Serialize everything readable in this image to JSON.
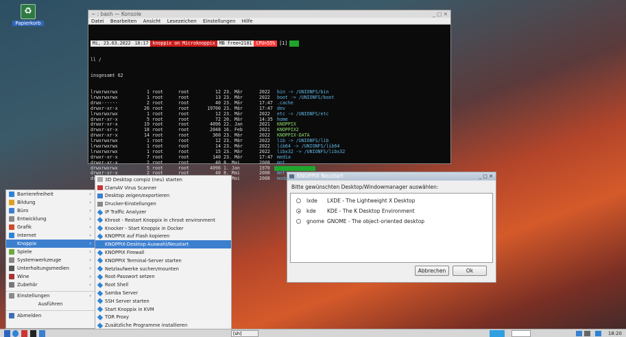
{
  "desktop": {
    "trash_label": "Papierkorb"
  },
  "terminal": {
    "title": "~ : bash — Konsole",
    "controls": "_ □ ✕",
    "menu": [
      "Datei",
      "Bearbeiten",
      "Ansicht",
      "Lesezeichen",
      "Einstellungen",
      "Hilfe"
    ],
    "status": {
      "date": "Mi, 23.03.2022",
      "time": "18:17",
      "host": "knoppix on Microknoppix",
      "mem": "MB free=2101",
      "cpu": "CPU=55%",
      "tag": "[1]"
    },
    "cmd": "ll /",
    "total": "insgesamt 62",
    "rows": [
      {
        "perm": "lrwxrwxrwx",
        "links": "1",
        "owner": "root",
        "group": "root",
        "size": "12",
        "date": "23. Mär",
        "time": "2022",
        "name": "bin -> /UNIONFS/bin"
      },
      {
        "perm": "lrwxrwxrwx",
        "links": "1",
        "owner": "root",
        "group": "root",
        "size": "13",
        "date": "23. Mär",
        "time": "2022",
        "name": "boot -> /UNIONFS/boot"
      },
      {
        "perm": "drwx------",
        "links": "2",
        "owner": "root",
        "group": "root",
        "size": "40",
        "date": "23. Mär",
        "time": "17:47",
        "name": ".cache"
      },
      {
        "perm": "drwxr-xr-x",
        "links": "26",
        "owner": "root",
        "group": "root",
        "size": "19700",
        "date": "23. Mär",
        "time": "17:47",
        "name": "dev"
      },
      {
        "perm": "lrwxrwxrwx",
        "links": "1",
        "owner": "root",
        "group": "root",
        "size": "12",
        "date": "23. Mär",
        "time": "2022",
        "name": "etc -> /UNIONFS/etc"
      },
      {
        "perm": "drwxr-xr-x",
        "links": "5",
        "owner": "root",
        "group": "root",
        "size": "72",
        "date": "20. Mär",
        "time": "14:35",
        "name": "home"
      },
      {
        "perm": "drwxr-xr-x",
        "links": "19",
        "owner": "root",
        "group": "root",
        "size": "4096",
        "date": "22. Jan",
        "time": "2021",
        "name": "KNOPPIX"
      },
      {
        "perm": "drwxr-xr-x",
        "links": "18",
        "owner": "root",
        "group": "root",
        "size": "2048",
        "date": "16. Feb",
        "time": "2021",
        "name": "KNOPPIX2"
      },
      {
        "perm": "drwxr-xr-x",
        "links": "14",
        "owner": "root",
        "group": "root",
        "size": "360",
        "date": "23. Mär",
        "time": "2022",
        "name": "KNOPPIX-DATA"
      },
      {
        "perm": "lrwxrwxrwx",
        "links": "1",
        "owner": "root",
        "group": "root",
        "size": "12",
        "date": "23. Mär",
        "time": "2022",
        "name": "lib -> /UNIONFS/lib"
      },
      {
        "perm": "lrwxrwxrwx",
        "links": "1",
        "owner": "root",
        "group": "root",
        "size": "14",
        "date": "23. Mär",
        "time": "2022",
        "name": "lib64 -> /UNIONFS/lib64"
      },
      {
        "perm": "lrwxrwxrwx",
        "links": "1",
        "owner": "root",
        "group": "root",
        "size": "15",
        "date": "23. Mär",
        "time": "2022",
        "name": "libx32 -> /UNIONFS/libx32"
      },
      {
        "perm": "drwxr-xr-x",
        "links": "7",
        "owner": "root",
        "group": "root",
        "size": "140",
        "date": "23. Mär",
        "time": "17:47",
        "name": "media"
      },
      {
        "perm": "drwxr-xr-x",
        "links": "2",
        "owner": "root",
        "group": "root",
        "size": "40",
        "date": "8. Mai",
        "time": "2008",
        "name": "mnt"
      },
      {
        "perm": "drwxrwxrwx",
        "links": "5",
        "owner": "root",
        "group": "root",
        "size": "4096",
        "date": "1. Jan",
        "time": "1970",
        "name": ""
      },
      {
        "perm": "drwxr-xr-x",
        "links": "2",
        "owner": "root",
        "group": "root",
        "size": "40",
        "date": "8. Mai",
        "time": "2008",
        "name": "mnt-user"
      },
      {
        "perm": "drwxr-xr-x",
        "links": "2",
        "owner": "root",
        "group": "root",
        "size": "40",
        "date": "8. Mai",
        "time": "2008",
        "name": "modules"
      }
    ]
  },
  "dialog": {
    "title": "KNOPPIX Neustart",
    "controls": "_ □ ✕",
    "prompt": "Bitte gewünschten Desktop/Windowmanager auswählen:",
    "options": [
      {
        "key": "lxde",
        "desc": "LXDE - The Lightweight X Desktop",
        "selected": false
      },
      {
        "key": "kde",
        "desc": "KDE - The K Desktop Environment",
        "selected": true
      },
      {
        "key": "gnome",
        "desc": "GNOME - The object-oriented desktop",
        "selected": false
      }
    ],
    "cancel": "Abbrechen",
    "ok": "Ok"
  },
  "menu": {
    "items": [
      "Barrierefreiheit",
      "Bildung",
      "Büro",
      "Entwicklung",
      "Grafik",
      "Internet",
      "Knoppix",
      "Spiele",
      "Systemwerkzeuge",
      "Unterhaltungsmedien",
      "Wine",
      "Zubehör"
    ],
    "settings": "Einstellungen",
    "run": "Ausführen",
    "logout": "Abmelden"
  },
  "submenu": {
    "items": [
      "3D Desktop compiz (neu) starten",
      "ClamAV Virus Scanner",
      "Desktop zeigen/exportieren",
      "Drucker-Einstellungen",
      "IP Traffic Analyzer",
      "Khroot - Restart Knoppix in chroot environment",
      "Knocker - Start Knoppix in Docker",
      "KNOPPIX auf Flash kopieren",
      "KNOPPIX-Desktop Auswahl/Neustart",
      "KNOPPIX Firewall",
      "KNOPPIX Terminal-Server starten",
      "Netzlaufwerke suchen/mounten",
      "Root-Passwort setzen",
      "Root Shell",
      "Samba Server",
      "SSH Server starten",
      "Start Knoppix in KVM",
      "TOR Proxy",
      "Zusätzliche Programme installieren"
    ]
  },
  "taskbar": {
    "task": "[sh]",
    "clock": "18:20"
  }
}
